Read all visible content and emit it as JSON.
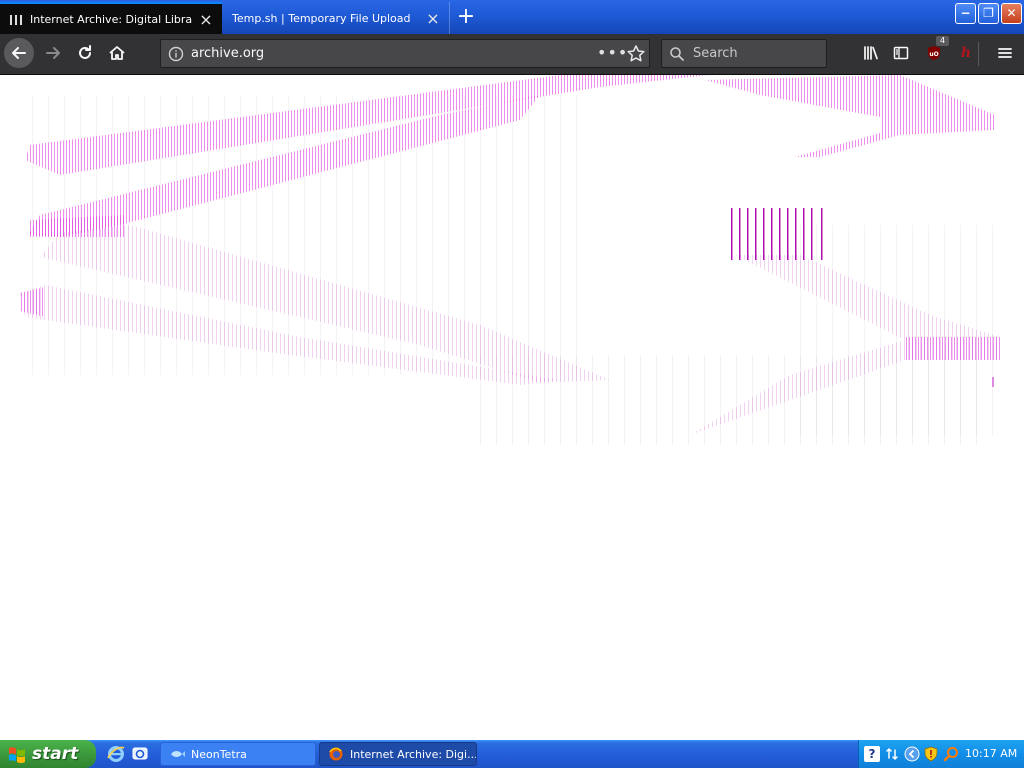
{
  "browser": {
    "tabs": [
      {
        "title": "Internet Archive: Digital Library of Free & Borrowable Books, Movies, Music & Wayback Machine",
        "active": true
      },
      {
        "title": "Temp.sh | Temporary File Upload",
        "active": false
      }
    ],
    "new_tab": "+",
    "window_controls": {
      "minimize": "−",
      "maximize": "❐",
      "close": "✕"
    },
    "url": "archive.org",
    "search_placeholder": "Search",
    "page_actions": "•••",
    "ublock_count": "4",
    "ext_h_label": "h"
  },
  "taskbar": {
    "start_label": "start",
    "buttons": [
      {
        "label": "NeonTetra"
      },
      {
        "label": "Internet Archive: Digi..."
      }
    ],
    "clock": "10:17 AM",
    "help_glyph": "?"
  },
  "colors": {
    "accent_tab": "#0a84ff",
    "glitch_magenta": "#e030e0",
    "xp_blue": "#245edb",
    "xp_green": "#3c9a3c"
  }
}
